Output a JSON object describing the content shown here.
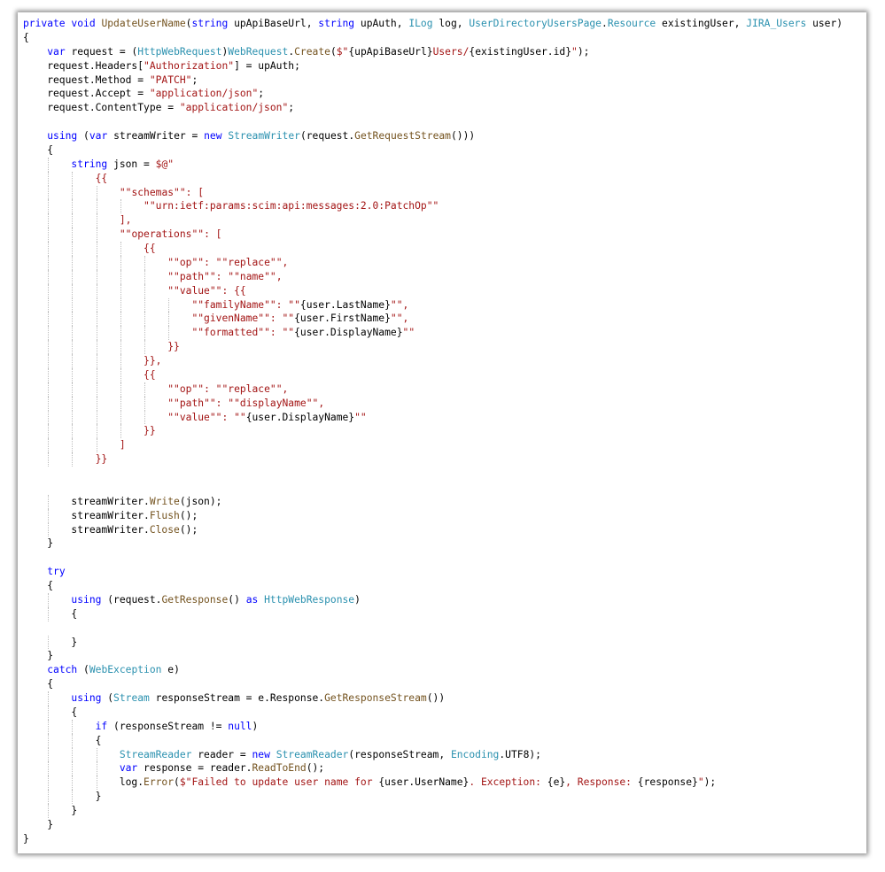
{
  "colors": {
    "keyword": "#0000ff",
    "type": "#2b91af",
    "method": "#74531f",
    "string": "#a31515",
    "placeholder": "#000000",
    "brace": "#a31515",
    "text": "#000000",
    "punct": "#000000",
    "interp": "#a31515"
  },
  "code_lines": [
    [
      [
        "keyword",
        "private "
      ],
      [
        "keyword",
        "void "
      ],
      [
        "method",
        "UpdateUserName"
      ],
      [
        "text",
        "("
      ],
      [
        "keyword",
        "string "
      ],
      [
        "text",
        "upApiBaseUrl, "
      ],
      [
        "keyword",
        "string "
      ],
      [
        "text",
        "upAuth, "
      ],
      [
        "type",
        "ILog "
      ],
      [
        "text",
        "log, "
      ],
      [
        "type",
        "UserDirectoryUsersPage"
      ],
      [
        "text",
        "."
      ],
      [
        "type",
        "Resource "
      ],
      [
        "text",
        "existingUser, "
      ],
      [
        "type",
        "JIRA_Users "
      ],
      [
        "text",
        "user)"
      ]
    ],
    [
      [
        "text",
        "{"
      ]
    ],
    [
      [
        "text",
        "    "
      ],
      [
        "keyword",
        "var "
      ],
      [
        "text",
        "request = ("
      ],
      [
        "type",
        "HttpWebRequest"
      ],
      [
        "text",
        ")"
      ],
      [
        "type",
        "WebRequest"
      ],
      [
        "text",
        "."
      ],
      [
        "method",
        "Create"
      ],
      [
        "text",
        "("
      ],
      [
        "string",
        "$\""
      ],
      [
        "text",
        "{upApiBaseUrl}"
      ],
      [
        "string",
        "Users/"
      ],
      [
        "text",
        "{existingUser.id}"
      ],
      [
        "string",
        "\""
      ],
      [
        "text",
        ");"
      ]
    ],
    [
      [
        "text",
        "    request.Headers["
      ],
      [
        "string",
        "\"Authorization\""
      ],
      [
        "text",
        "] = upAuth;"
      ]
    ],
    [
      [
        "text",
        "    request.Method = "
      ],
      [
        "string",
        "\"PATCH\""
      ],
      [
        "text",
        ";"
      ]
    ],
    [
      [
        "text",
        "    request.Accept = "
      ],
      [
        "string",
        "\"application/json\""
      ],
      [
        "text",
        ";"
      ]
    ],
    [
      [
        "text",
        "    request.ContentType = "
      ],
      [
        "string",
        "\"application/json\""
      ],
      [
        "text",
        ";"
      ]
    ],
    [
      [
        "text",
        ""
      ]
    ],
    [
      [
        "text",
        "    "
      ],
      [
        "keyword",
        "using "
      ],
      [
        "text",
        "("
      ],
      [
        "keyword",
        "var "
      ],
      [
        "text",
        "streamWriter = "
      ],
      [
        "keyword",
        "new "
      ],
      [
        "type",
        "StreamWriter"
      ],
      [
        "text",
        "(request."
      ],
      [
        "method",
        "GetRequestStream"
      ],
      [
        "text",
        "()))"
      ]
    ],
    [
      [
        "text",
        "    {"
      ]
    ],
    [
      [
        "text",
        "        "
      ],
      [
        "keyword",
        "string "
      ],
      [
        "text",
        "json = "
      ],
      [
        "string",
        "$@\""
      ]
    ],
    [
      [
        "text",
        "            "
      ],
      [
        "brace",
        "{{"
      ]
    ],
    [
      [
        "text",
        "                "
      ],
      [
        "string",
        "\"\""
      ],
      [
        "string",
        "schemas"
      ],
      [
        "string",
        "\"\""
      ],
      [
        "string",
        ": ["
      ]
    ],
    [
      [
        "text",
        "                    "
      ],
      [
        "string",
        "\"\""
      ],
      [
        "string",
        "urn:ietf:params:scim:api:messages:2.0:PatchOp"
      ],
      [
        "string",
        "\"\""
      ]
    ],
    [
      [
        "text",
        "                "
      ],
      [
        "string",
        "],"
      ]
    ],
    [
      [
        "text",
        "                "
      ],
      [
        "string",
        "\"\""
      ],
      [
        "string",
        "operations"
      ],
      [
        "string",
        "\"\""
      ],
      [
        "string",
        ": ["
      ]
    ],
    [
      [
        "text",
        "                    "
      ],
      [
        "brace",
        "{{"
      ]
    ],
    [
      [
        "text",
        "                        "
      ],
      [
        "string",
        "\"\""
      ],
      [
        "string",
        "op"
      ],
      [
        "string",
        "\"\""
      ],
      [
        "string",
        ": "
      ],
      [
        "string",
        "\"\""
      ],
      [
        "string",
        "replace"
      ],
      [
        "string",
        "\"\""
      ],
      [
        "string",
        ","
      ]
    ],
    [
      [
        "text",
        "                        "
      ],
      [
        "string",
        "\"\""
      ],
      [
        "string",
        "path"
      ],
      [
        "string",
        "\"\""
      ],
      [
        "string",
        ": "
      ],
      [
        "string",
        "\"\""
      ],
      [
        "string",
        "name"
      ],
      [
        "string",
        "\"\""
      ],
      [
        "string",
        ","
      ]
    ],
    [
      [
        "text",
        "                        "
      ],
      [
        "string",
        "\"\""
      ],
      [
        "string",
        "value"
      ],
      [
        "string",
        "\"\""
      ],
      [
        "string",
        ": "
      ],
      [
        "brace",
        "{{"
      ]
    ],
    [
      [
        "text",
        "                            "
      ],
      [
        "string",
        "\"\""
      ],
      [
        "string",
        "familyName"
      ],
      [
        "string",
        "\"\""
      ],
      [
        "string",
        ": "
      ],
      [
        "string",
        "\"\""
      ],
      [
        "text",
        "{user.LastName}"
      ],
      [
        "string",
        "\"\""
      ],
      [
        "string",
        ","
      ]
    ],
    [
      [
        "text",
        "                            "
      ],
      [
        "string",
        "\"\""
      ],
      [
        "string",
        "givenName"
      ],
      [
        "string",
        "\"\""
      ],
      [
        "string",
        ": "
      ],
      [
        "string",
        "\"\""
      ],
      [
        "text",
        "{user.FirstName}"
      ],
      [
        "string",
        "\"\""
      ],
      [
        "string",
        ","
      ]
    ],
    [
      [
        "text",
        "                            "
      ],
      [
        "string",
        "\"\""
      ],
      [
        "string",
        "formatted"
      ],
      [
        "string",
        "\"\""
      ],
      [
        "string",
        ": "
      ],
      [
        "string",
        "\"\""
      ],
      [
        "text",
        "{user.DisplayName}"
      ],
      [
        "string",
        "\"\""
      ]
    ],
    [
      [
        "text",
        "                        "
      ],
      [
        "brace",
        "}}"
      ]
    ],
    [
      [
        "text",
        "                    "
      ],
      [
        "brace",
        "}}"
      ],
      [
        "string",
        ","
      ]
    ],
    [
      [
        "text",
        "                    "
      ],
      [
        "brace",
        "{{"
      ]
    ],
    [
      [
        "text",
        "                        "
      ],
      [
        "string",
        "\"\""
      ],
      [
        "string",
        "op"
      ],
      [
        "string",
        "\"\""
      ],
      [
        "string",
        ": "
      ],
      [
        "string",
        "\"\""
      ],
      [
        "string",
        "replace"
      ],
      [
        "string",
        "\"\""
      ],
      [
        "string",
        ","
      ]
    ],
    [
      [
        "text",
        "                        "
      ],
      [
        "string",
        "\"\""
      ],
      [
        "string",
        "path"
      ],
      [
        "string",
        "\"\""
      ],
      [
        "string",
        ": "
      ],
      [
        "string",
        "\"\""
      ],
      [
        "string",
        "displayName"
      ],
      [
        "string",
        "\"\""
      ],
      [
        "string",
        ","
      ]
    ],
    [
      [
        "text",
        "                        "
      ],
      [
        "string",
        "\"\""
      ],
      [
        "string",
        "value"
      ],
      [
        "string",
        "\"\""
      ],
      [
        "string",
        ": "
      ],
      [
        "string",
        "\"\""
      ],
      [
        "text",
        "{user.DisplayName}"
      ],
      [
        "string",
        "\"\""
      ]
    ],
    [
      [
        "text",
        "                    "
      ],
      [
        "brace",
        "}}"
      ]
    ],
    [
      [
        "text",
        "                "
      ],
      [
        "string",
        "]"
      ]
    ],
    [
      [
        "text",
        "            "
      ],
      [
        "brace",
        "}}"
      ]
    ],
    [
      [
        "text",
        ""
      ]
    ],
    [
      [
        "text",
        ""
      ]
    ],
    [
      [
        "text",
        "        streamWriter."
      ],
      [
        "method",
        "Write"
      ],
      [
        "text",
        "(json);"
      ]
    ],
    [
      [
        "text",
        "        streamWriter."
      ],
      [
        "method",
        "Flush"
      ],
      [
        "text",
        "();"
      ]
    ],
    [
      [
        "text",
        "        streamWriter."
      ],
      [
        "method",
        "Close"
      ],
      [
        "text",
        "();"
      ]
    ],
    [
      [
        "text",
        "    }"
      ]
    ],
    [
      [
        "text",
        ""
      ]
    ],
    [
      [
        "text",
        "    "
      ],
      [
        "keyword",
        "try"
      ]
    ],
    [
      [
        "text",
        "    {"
      ]
    ],
    [
      [
        "text",
        "        "
      ],
      [
        "keyword",
        "using "
      ],
      [
        "text",
        "(request."
      ],
      [
        "method",
        "GetResponse"
      ],
      [
        "text",
        "() "
      ],
      [
        "keyword",
        "as "
      ],
      [
        "type",
        "HttpWebResponse"
      ],
      [
        "text",
        ")"
      ]
    ],
    [
      [
        "text",
        "        {"
      ]
    ],
    [
      [
        "text",
        ""
      ]
    ],
    [
      [
        "text",
        "        }"
      ]
    ],
    [
      [
        "text",
        "    }"
      ]
    ],
    [
      [
        "text",
        "    "
      ],
      [
        "keyword",
        "catch "
      ],
      [
        "text",
        "("
      ],
      [
        "type",
        "WebException "
      ],
      [
        "text",
        "e)"
      ]
    ],
    [
      [
        "text",
        "    {"
      ]
    ],
    [
      [
        "text",
        "        "
      ],
      [
        "keyword",
        "using "
      ],
      [
        "text",
        "("
      ],
      [
        "type",
        "Stream "
      ],
      [
        "text",
        "responseStream = e.Response."
      ],
      [
        "method",
        "GetResponseStream"
      ],
      [
        "text",
        "())"
      ]
    ],
    [
      [
        "text",
        "        {"
      ]
    ],
    [
      [
        "text",
        "            "
      ],
      [
        "keyword",
        "if "
      ],
      [
        "text",
        "(responseStream != "
      ],
      [
        "keyword",
        "null"
      ],
      [
        "text",
        ")"
      ]
    ],
    [
      [
        "text",
        "            {"
      ]
    ],
    [
      [
        "text",
        "                "
      ],
      [
        "type",
        "StreamReader "
      ],
      [
        "text",
        "reader = "
      ],
      [
        "keyword",
        "new "
      ],
      [
        "type",
        "StreamReader"
      ],
      [
        "text",
        "(responseStream, "
      ],
      [
        "type",
        "Encoding"
      ],
      [
        "text",
        ".UTF8);"
      ]
    ],
    [
      [
        "text",
        "                "
      ],
      [
        "keyword",
        "var "
      ],
      [
        "text",
        "response = reader."
      ],
      [
        "method",
        "ReadToEnd"
      ],
      [
        "text",
        "();"
      ]
    ],
    [
      [
        "text",
        "                log."
      ],
      [
        "method",
        "Error"
      ],
      [
        "text",
        "("
      ],
      [
        "string",
        "$\"Failed to update user name for "
      ],
      [
        "text",
        "{user.UserName}"
      ],
      [
        "string",
        ". Exception: "
      ],
      [
        "text",
        "{e}"
      ],
      [
        "string",
        ", Response: "
      ],
      [
        "text",
        "{response}"
      ],
      [
        "string",
        "\""
      ],
      [
        "text",
        ");"
      ]
    ],
    [
      [
        "text",
        "            }"
      ]
    ],
    [
      [
        "text",
        "        }"
      ]
    ],
    [
      [
        "text",
        "    }"
      ]
    ],
    [
      [
        "text",
        "}"
      ]
    ]
  ]
}
